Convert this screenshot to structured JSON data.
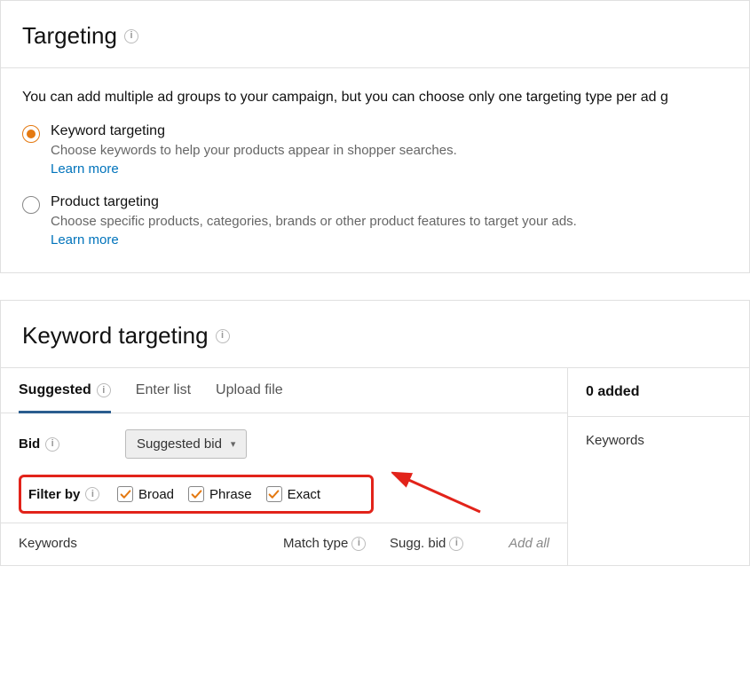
{
  "targeting": {
    "title": "Targeting",
    "intro": "You can add multiple ad groups to your campaign, but you can choose only one targeting type per ad g",
    "options": [
      {
        "label": "Keyword targeting",
        "desc": "Choose keywords to help your products appear in shopper searches.",
        "link": "Learn more",
        "selected": true
      },
      {
        "label": "Product targeting",
        "desc": "Choose specific products, categories, brands or other product features to target your ads.",
        "link": "Learn more",
        "selected": false
      }
    ]
  },
  "keyword": {
    "title": "Keyword targeting",
    "tabs": [
      "Suggested",
      "Enter list",
      "Upload file"
    ],
    "bid_label": "Bid",
    "bid_select": "Suggested bid",
    "filter_label": "Filter by",
    "filters": [
      {
        "label": "Broad",
        "checked": true
      },
      {
        "label": "Phrase",
        "checked": true
      },
      {
        "label": "Exact",
        "checked": true
      }
    ],
    "table": {
      "keywords": "Keywords",
      "match_type": "Match type",
      "sugg_bid": "Sugg. bid",
      "add_all": "Add all"
    },
    "right": {
      "added": "0 added",
      "col": "Keywords"
    }
  }
}
